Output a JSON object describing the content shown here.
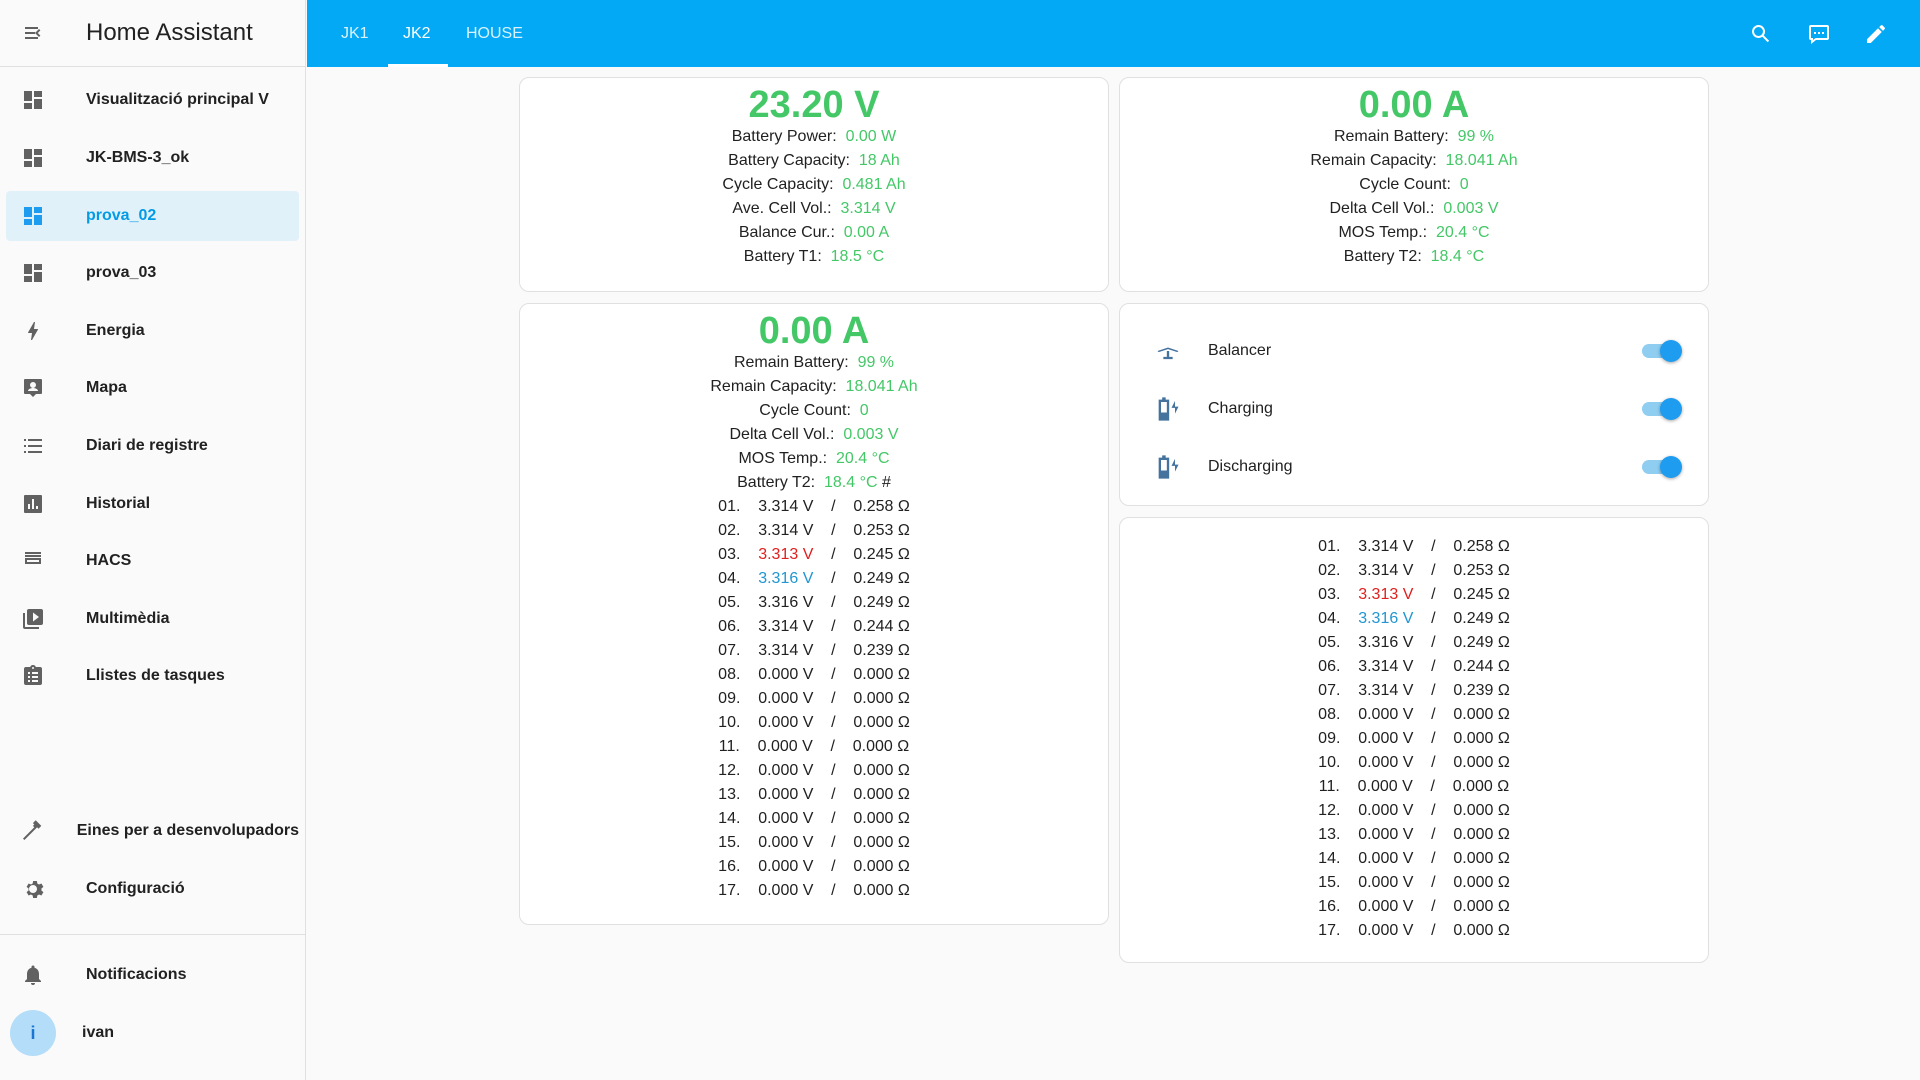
{
  "app": {
    "title": "Home Assistant"
  },
  "sidebar": {
    "items": [
      {
        "label": "Visualització principal V",
        "icon": "dashboard-icon"
      },
      {
        "label": "JK-BMS-3_ok",
        "icon": "dashboard-icon"
      },
      {
        "label": "prova_02",
        "icon": "dashboard-icon",
        "active": true
      },
      {
        "label": "prova_03",
        "icon": "dashboard-icon"
      },
      {
        "label": "Energia",
        "icon": "lightning-icon"
      },
      {
        "label": "Mapa",
        "icon": "map-pin-icon"
      },
      {
        "label": "Diari de registre",
        "icon": "list-icon"
      },
      {
        "label": "Historial",
        "icon": "chart-icon"
      },
      {
        "label": "HACS",
        "icon": "hacs-icon"
      },
      {
        "label": "Multimèdia",
        "icon": "media-icon"
      },
      {
        "label": "Llistes de tasques",
        "icon": "clipboard-icon"
      },
      {
        "label": "Eines per a desenvolupadors",
        "icon": "hammer-icon"
      },
      {
        "label": "Configuració",
        "icon": "gear-icon"
      }
    ],
    "notifications_label": "Notificacions",
    "user": {
      "initial": "i",
      "name": "ivan"
    }
  },
  "header": {
    "tabs": [
      "JK1",
      "JK2",
      "HOUSE"
    ],
    "active_tab": "JK2",
    "actions": [
      "search-icon",
      "assist-icon",
      "edit-icon"
    ]
  },
  "cards": {
    "card1": {
      "headline": "23.20 V",
      "rows": [
        {
          "label": "Battery Power:",
          "value": "0.00 W"
        },
        {
          "label": "Battery Capacity:",
          "value": "18 Ah"
        },
        {
          "label": "Cycle Capacity:",
          "value": "0.481 Ah"
        },
        {
          "label": "Ave. Cell Vol.:",
          "value": "3.314 V"
        },
        {
          "label": "Balance Cur.:",
          "value": "0.00 A"
        },
        {
          "label": "Battery T1:",
          "value": "18.5 °C"
        }
      ]
    },
    "card2": {
      "headline": "0.00 A",
      "rows": [
        {
          "label": "Remain Battery:",
          "value": "99 %"
        },
        {
          "label": "Remain Capacity:",
          "value": "18.041 Ah"
        },
        {
          "label": "Cycle Count:",
          "value": "0"
        },
        {
          "label": "Delta Cell Vol.:",
          "value": "0.003 V"
        },
        {
          "label": "MOS Temp.:",
          "value": "20.4 °C"
        },
        {
          "label": "Battery T2:",
          "value": "18.4 °C"
        }
      ]
    },
    "card3": {
      "headline": "0.00 A",
      "rows": [
        {
          "label": "Remain Battery:",
          "value": "99 %"
        },
        {
          "label": "Remain Capacity:",
          "value": "18.041 Ah"
        },
        {
          "label": "Cycle Count:",
          "value": "0"
        },
        {
          "label": "Delta Cell Vol.:",
          "value": "0.003 V"
        },
        {
          "label": "MOS Temp.:",
          "value": "20.4 °C"
        },
        {
          "label": "Battery T2:",
          "value": "18.4 °C",
          "suffix": " #"
        }
      ]
    },
    "switches": [
      {
        "label": "Balancer",
        "icon": "balancer-icon",
        "on": true
      },
      {
        "label": "Charging",
        "icon": "battery-charging-icon",
        "on": true
      },
      {
        "label": "Discharging",
        "icon": "battery-charging-icon",
        "on": true
      }
    ],
    "cells": [
      {
        "idx": "01.",
        "volt": "3.314 V",
        "res": "0.258 Ω",
        "state": "normal"
      },
      {
        "idx": "02.",
        "volt": "3.314 V",
        "res": "0.253 Ω",
        "state": "normal"
      },
      {
        "idx": "03.",
        "volt": "3.313 V",
        "res": "0.245 Ω",
        "state": "min"
      },
      {
        "idx": "04.",
        "volt": "3.316 V",
        "res": "0.249 Ω",
        "state": "max"
      },
      {
        "idx": "05.",
        "volt": "3.316 V",
        "res": "0.249 Ω",
        "state": "normal"
      },
      {
        "idx": "06.",
        "volt": "3.314 V",
        "res": "0.244 Ω",
        "state": "normal"
      },
      {
        "idx": "07.",
        "volt": "3.314 V",
        "res": "0.239 Ω",
        "state": "normal"
      },
      {
        "idx": "08.",
        "volt": "0.000 V",
        "res": "0.000 Ω",
        "state": "normal"
      },
      {
        "idx": "09.",
        "volt": "0.000 V",
        "res": "0.000 Ω",
        "state": "normal"
      },
      {
        "idx": "10.",
        "volt": "0.000 V",
        "res": "0.000 Ω",
        "state": "normal"
      },
      {
        "idx": "11.",
        "volt": "0.000 V",
        "res": "0.000 Ω",
        "state": "normal"
      },
      {
        "idx": "12.",
        "volt": "0.000 V",
        "res": "0.000 Ω",
        "state": "normal"
      },
      {
        "idx": "13.",
        "volt": "0.000 V",
        "res": "0.000 Ω",
        "state": "normal"
      },
      {
        "idx": "14.",
        "volt": "0.000 V",
        "res": "0.000 Ω",
        "state": "normal"
      },
      {
        "idx": "15.",
        "volt": "0.000 V",
        "res": "0.000 Ω",
        "state": "normal"
      },
      {
        "idx": "16.",
        "volt": "0.000 V",
        "res": "0.000 Ω",
        "state": "normal"
      },
      {
        "idx": "17.",
        "volt": "0.000 V",
        "res": "0.000 Ω",
        "state": "normal"
      }
    ],
    "separator": "/"
  },
  "colors": {
    "header": "#03a9f4",
    "value_green": "#44c767",
    "min_red": "#e02020",
    "max_blue": "#2196d3",
    "active_bg": "#e1f1fa",
    "toggle": "#1e9cf0"
  }
}
